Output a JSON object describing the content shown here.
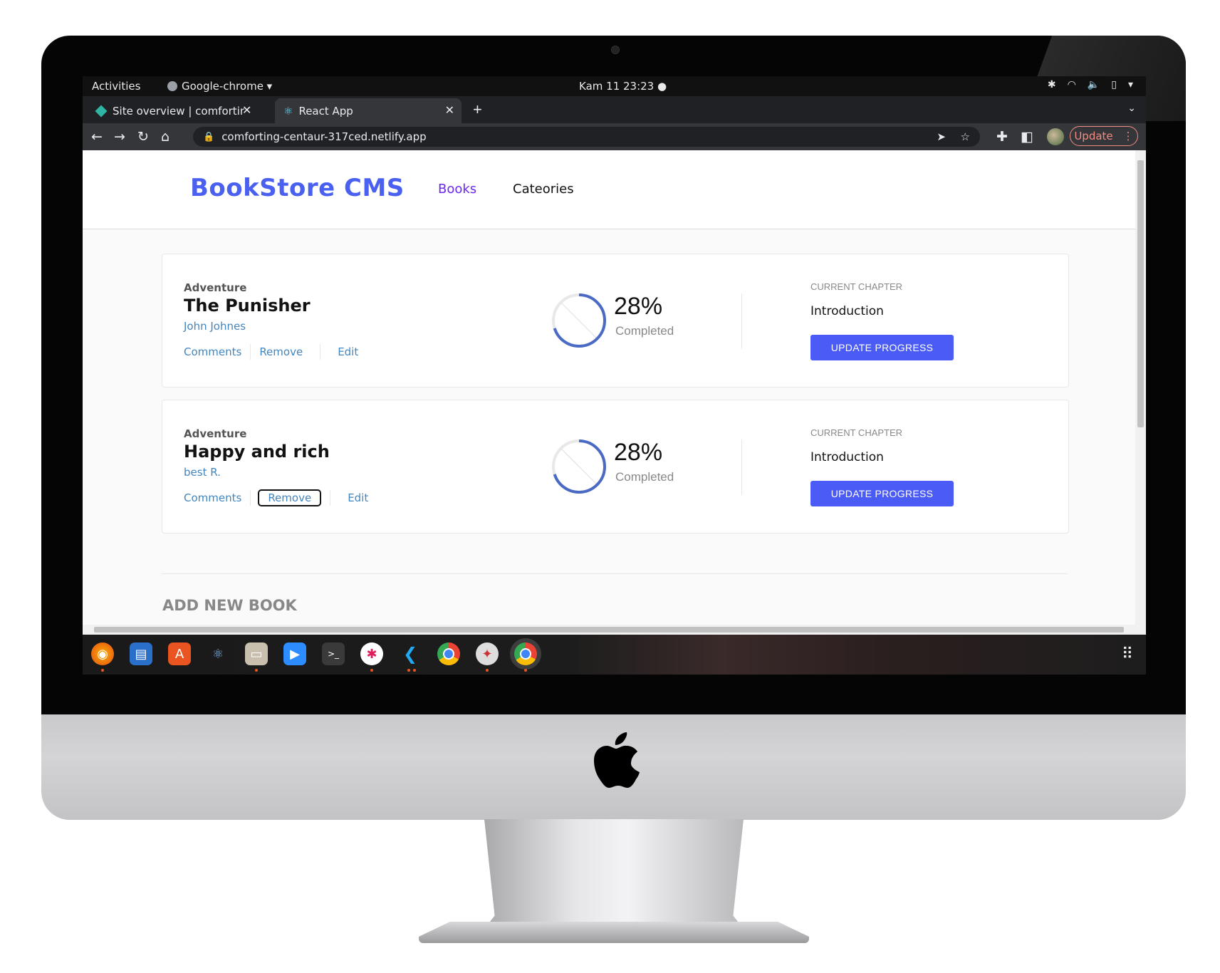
{
  "topbar": {
    "activities": "Activities",
    "app_menu": "Google-chrome ▾",
    "clock": "Kam 11  23:23  ●"
  },
  "tabs": [
    {
      "title": "Site overview | comfortin",
      "icon": "netlify-icon"
    },
    {
      "title": "React App",
      "icon": "react-icon"
    }
  ],
  "toolbar": {
    "url": "comforting-centaur-317ced.netlify.app",
    "update_label": "Update"
  },
  "site": {
    "logo": "BookStore CMS",
    "nav": {
      "books": "Books",
      "categories": "Cateories"
    },
    "accent_color": "#4960f0",
    "button_color": "#4a5bf6"
  },
  "books": [
    {
      "genre": "Adventure",
      "title": "The Punisher",
      "author": "John Johnes",
      "actions": [
        "Comments",
        "Remove",
        "Edit"
      ],
      "progress_percent": 28,
      "percent_label": "28%",
      "completed_label": "Completed",
      "chapter_label": "CURRENT CHAPTER",
      "chapter": "Introduction",
      "button": "UPDATE PROGRESS"
    },
    {
      "genre": "Adventure",
      "title": "Happy and rich",
      "author": "best R.",
      "actions": [
        "Comments",
        "Remove",
        "Edit"
      ],
      "progress_percent": 28,
      "percent_label": "28%",
      "completed_label": "Completed",
      "chapter_label": "CURRENT CHAPTER",
      "chapter": "Introduction",
      "button": "UPDATE PROGRESS"
    }
  ],
  "add_form": {
    "title": "ADD NEW BOOK"
  },
  "dock": {
    "apps": [
      "firefox-icon",
      "writer-icon",
      "app-center-icon",
      "atom-icon",
      "files-icon",
      "zoom-icon",
      "terminal-icon",
      "slack-icon",
      "vscode-icon",
      "chrome-icon",
      "compass-icon",
      "chrome-active-icon"
    ]
  }
}
